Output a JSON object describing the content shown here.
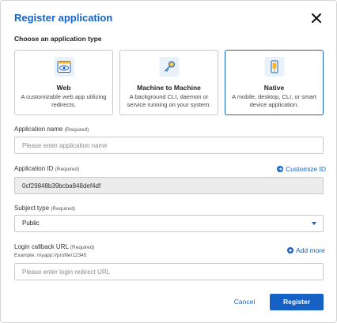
{
  "dialog": {
    "title": "Register application",
    "close_icon": "close-icon"
  },
  "app_type": {
    "label": "Choose an application type",
    "options": [
      {
        "name": "Web",
        "description": "A customizable web app utilizing redirects.",
        "icon": "browser-eye-icon",
        "selected": false
      },
      {
        "name": "Machine to Machine",
        "description": "A background CLI, daemon or service running on your system.",
        "icon": "key-icon",
        "selected": false
      },
      {
        "name": "Native",
        "description": "A mobile, desktop, CLI, or smart device application.",
        "icon": "mobile-device-icon",
        "selected": true
      }
    ]
  },
  "fields": {
    "app_name": {
      "label": "Application name",
      "required": "(Required)",
      "placeholder": "Please enter application name",
      "value": ""
    },
    "app_id": {
      "label": "Application ID",
      "required": "(Required)",
      "value": "0cf29848b39bcba848def4df",
      "customize_label": "Customize ID"
    },
    "subject_type": {
      "label": "Subject type",
      "required": "(Required)",
      "selected": "Public"
    },
    "login_callback": {
      "label": "Login callback URL",
      "required": "(Required)",
      "hint": "Example: myapp://profile/12345",
      "placeholder": "Please enter login redirect URL",
      "add_more_label": "Add more"
    }
  },
  "actions": {
    "cancel_label": "Cancel",
    "register_label": "Register"
  },
  "colors": {
    "accent": "#1662c4",
    "readonly_bg": "#ececec"
  }
}
